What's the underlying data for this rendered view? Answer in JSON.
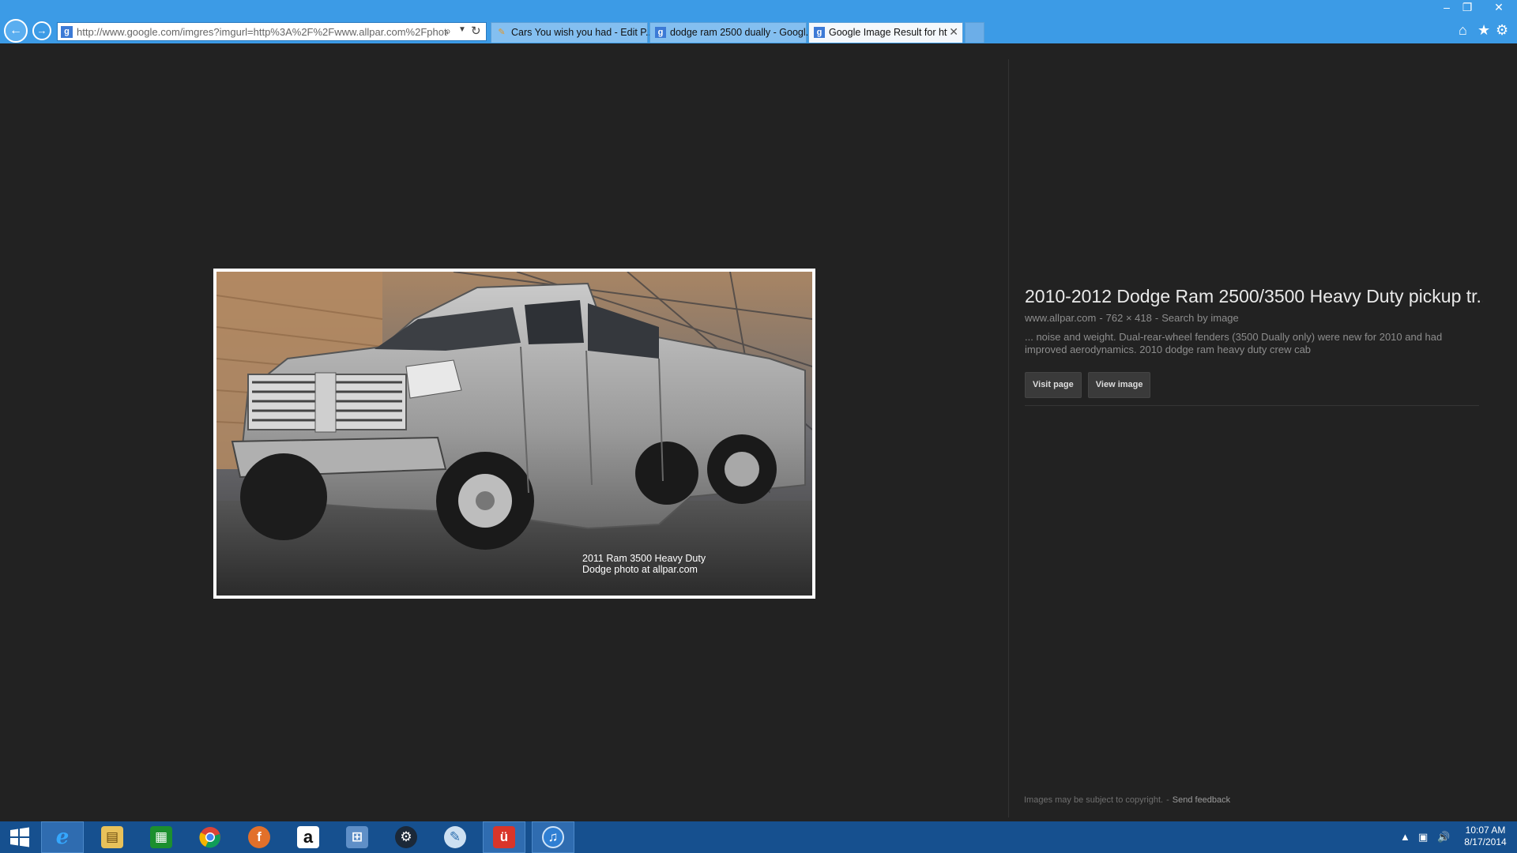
{
  "browser": {
    "url": "http://www.google.com/imgres?imgurl=http%3A%2F%2Fwww.allpar.com%2Fphotos%",
    "tabs": [
      {
        "label": "Cars You wish you had - Edit P...",
        "icon": "tapatalk-icon"
      },
      {
        "label": "dodge ram 2500 dually - Googl...",
        "icon": "google-icon"
      },
      {
        "label": "Google Image Result for htt...",
        "icon": "google-icon"
      }
    ],
    "window_controls": {
      "minimize": "–",
      "maximize": "❐",
      "close": "✕"
    }
  },
  "image": {
    "caption_line1": "2011 Ram 3500  Heavy Duty",
    "caption_line2": "Dodge photo at allpar.com"
  },
  "result": {
    "title": "2010-2012 Dodge Ram 2500/3500 Heavy Duty pickup tr...",
    "site": "www.allpar.com",
    "dimensions": "762 × 418",
    "search_by_image": "Search by image",
    "separator": "-",
    "description": "... noise and weight. Dual-rear-wheel fenders (3500 Dually only) were new for 2010 and had improved aerodynamics. 2010 dodge ram heavy duty crew cab",
    "visit_page": "Visit page",
    "view_image": "View image"
  },
  "footer": {
    "copyright": "Images may be subject to copyright.",
    "separator": "-",
    "send_feedback": "Send feedback"
  },
  "taskbar": {
    "time": "10:07 AM",
    "date": "8/17/2014",
    "apps": [
      "windows-start-icon",
      "internet-explorer-icon",
      "file-explorer-icon",
      "store-icon",
      "chrome-icon",
      "firefox-icon",
      "amazon-icon",
      "network-app-icon",
      "steam-icon",
      "paint-icon",
      "app-red-icon",
      "itunes-icon"
    ]
  }
}
